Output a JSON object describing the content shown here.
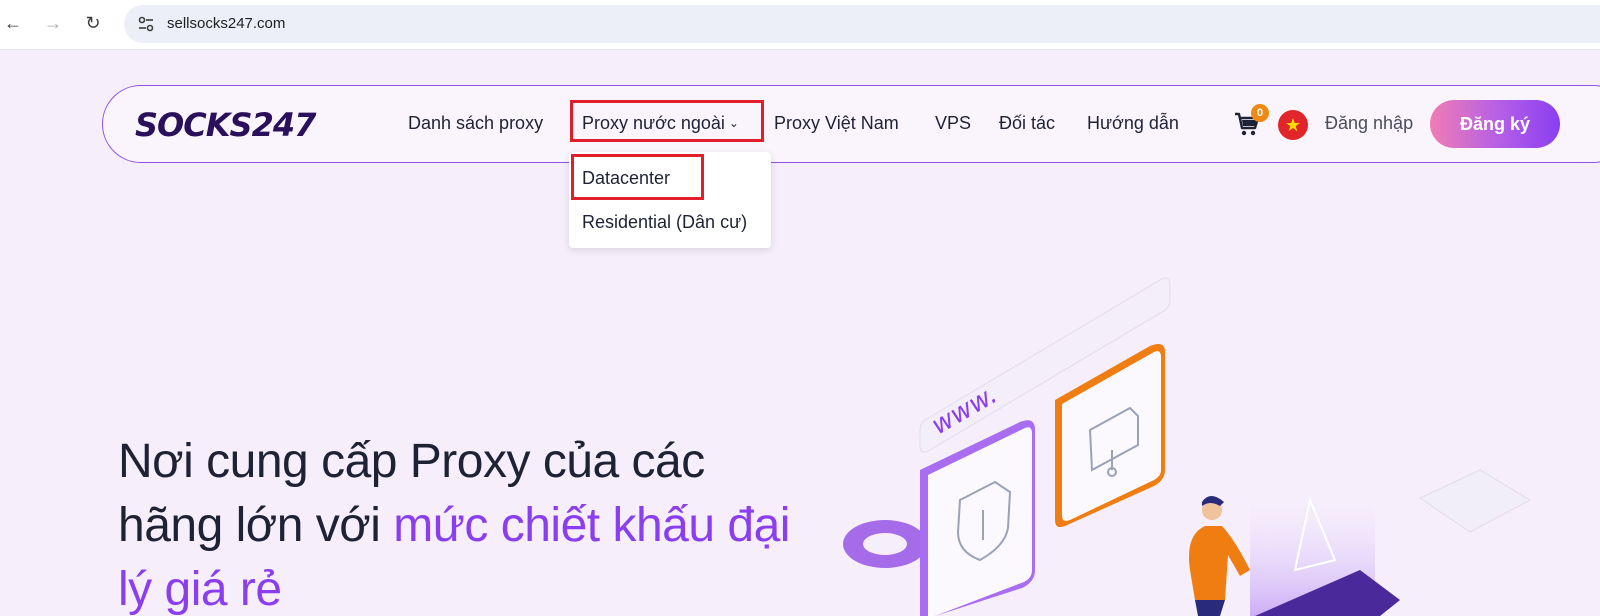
{
  "browser": {
    "url": "sellsocks247.com",
    "back_icon": "←",
    "forward_icon": "→",
    "reload_icon": "↻"
  },
  "header": {
    "logo_text": "SOCKS247",
    "nav": [
      {
        "label": "Danh sách proxy"
      },
      {
        "label": "Proxy nước ngoài",
        "chevron": "⌄"
      },
      {
        "label": "Proxy Việt Nam"
      },
      {
        "label": "VPS"
      },
      {
        "label": "Đối tác"
      },
      {
        "label": "Hướng dẫn"
      }
    ],
    "cart_count": "0",
    "flag_star": "★",
    "login": "Đăng nhập",
    "register": "Đăng ký"
  },
  "dropdown": {
    "items": [
      {
        "label": "Datacenter"
      },
      {
        "label": "Residential (Dân cư)"
      }
    ]
  },
  "hero": {
    "title_part1": "Nơi cung cấp Proxy của các hãng lớn với ",
    "title_accent": "mức chiết khấu đại lý giá rẻ",
    "illustration_text": "www."
  },
  "colors": {
    "accent": "#8a3ef0",
    "highlight": "#e21e2b",
    "background": "#f6eefb"
  }
}
